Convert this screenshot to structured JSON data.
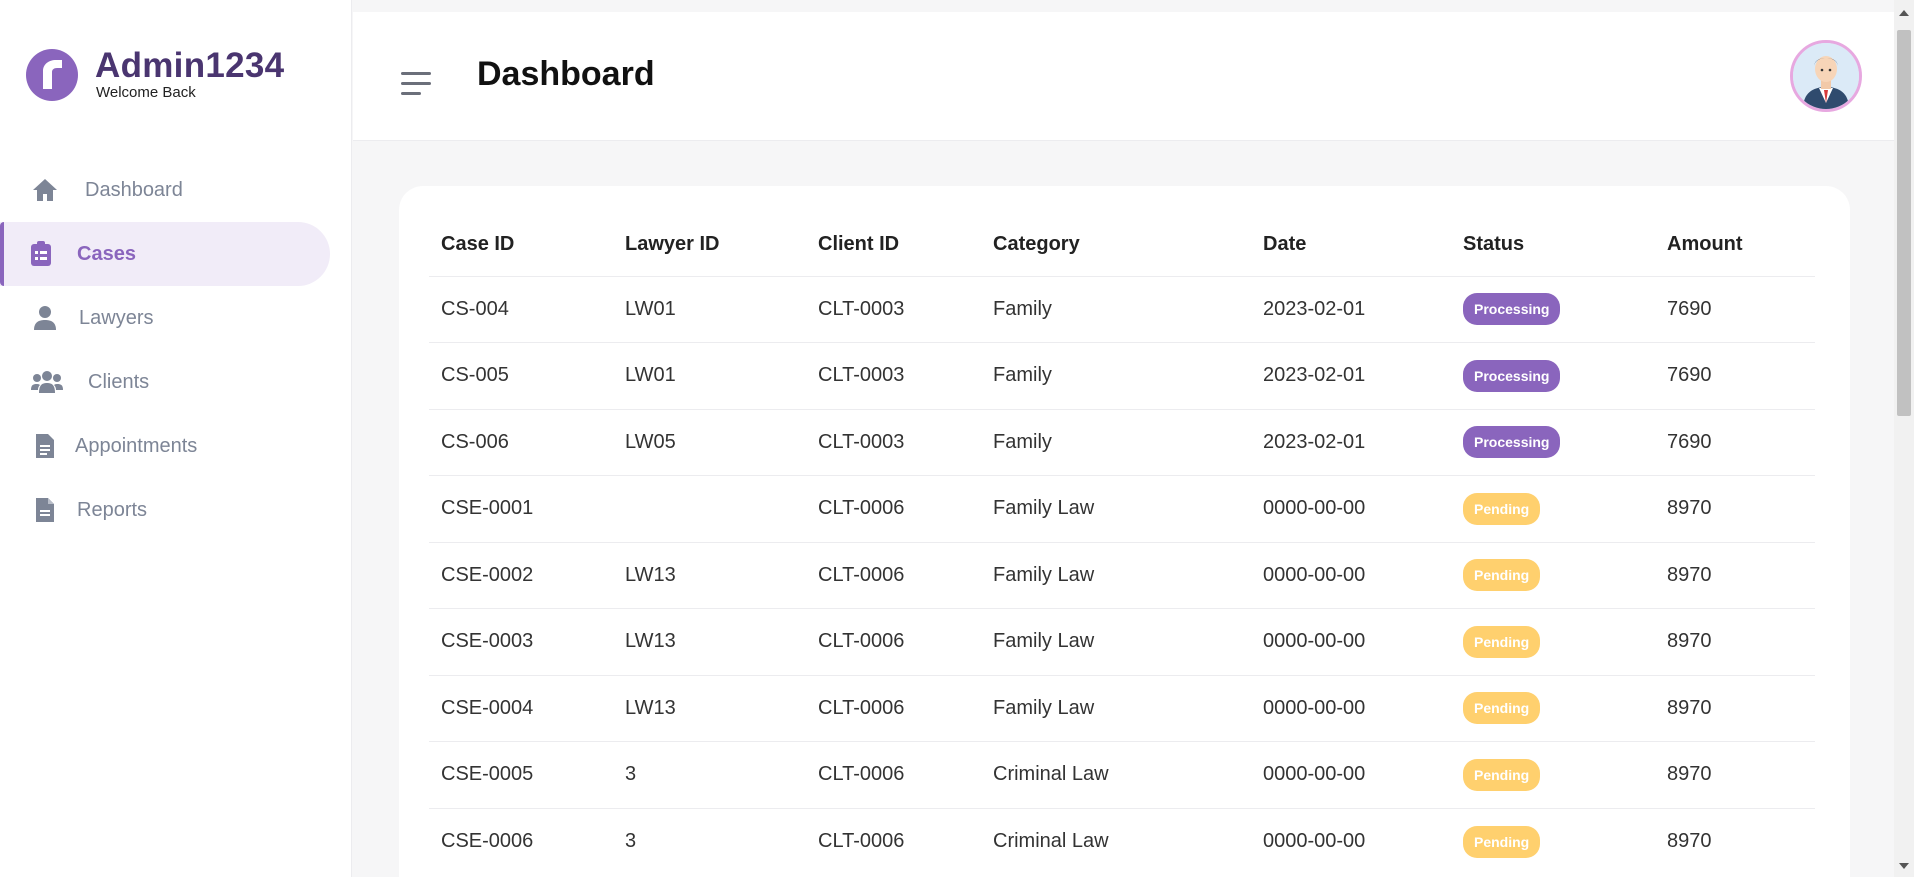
{
  "brand": {
    "title": "Admin1234",
    "subtitle": "Welcome Back",
    "logo_icon": "brand-logo-icon",
    "accent": "#8a65bd"
  },
  "sidebar": {
    "items": [
      {
        "label": "Dashboard",
        "icon": "home-icon",
        "active": false
      },
      {
        "label": "Cases",
        "icon": "clipboard-icon",
        "active": true
      },
      {
        "label": "Lawyers",
        "icon": "user-icon",
        "active": false
      },
      {
        "label": "Clients",
        "icon": "users-icon",
        "active": false
      },
      {
        "label": "Appointments",
        "icon": "document-icon",
        "active": false
      },
      {
        "label": "Reports",
        "icon": "file-icon",
        "active": false
      }
    ]
  },
  "header": {
    "title": "Dashboard",
    "menu_icon": "hamburger-menu-icon",
    "avatar_icon": "user-avatar"
  },
  "table": {
    "columns": [
      "Case ID",
      "Lawyer ID",
      "Client ID",
      "Category",
      "Date",
      "Status",
      "Amount"
    ],
    "rows": [
      [
        "CS-004",
        "LW01",
        "CLT-0003",
        "Family",
        "2023-02-01",
        "Processing",
        "7690"
      ],
      [
        "CS-005",
        "LW01",
        "CLT-0003",
        "Family",
        "2023-02-01",
        "Processing",
        "7690"
      ],
      [
        "CS-006",
        "LW05",
        "CLT-0003",
        "Family",
        "2023-02-01",
        "Processing",
        "7690"
      ],
      [
        "CSE-0001",
        "",
        "CLT-0006",
        "Family Law",
        "0000-00-00",
        "Pending",
        "8970"
      ],
      [
        "CSE-0002",
        "LW13",
        "CLT-0006",
        "Family Law",
        "0000-00-00",
        "Pending",
        "8970"
      ],
      [
        "CSE-0003",
        "LW13",
        "CLT-0006",
        "Family Law",
        "0000-00-00",
        "Pending",
        "8970"
      ],
      [
        "CSE-0004",
        "LW13",
        "CLT-0006",
        "Family Law",
        "0000-00-00",
        "Pending",
        "8970"
      ],
      [
        "CSE-0005",
        "3",
        "CLT-0006",
        "Criminal Law",
        "0000-00-00",
        "Pending",
        "8970"
      ],
      [
        "CSE-0006",
        "3",
        "CLT-0006",
        "Criminal Law",
        "0000-00-00",
        "Pending",
        "8970"
      ]
    ]
  },
  "colors": {
    "processing": "#8a65bd",
    "pending": "#ffd06e",
    "active_bg": "#f1ecf8",
    "muted_text": "#7d8596"
  }
}
